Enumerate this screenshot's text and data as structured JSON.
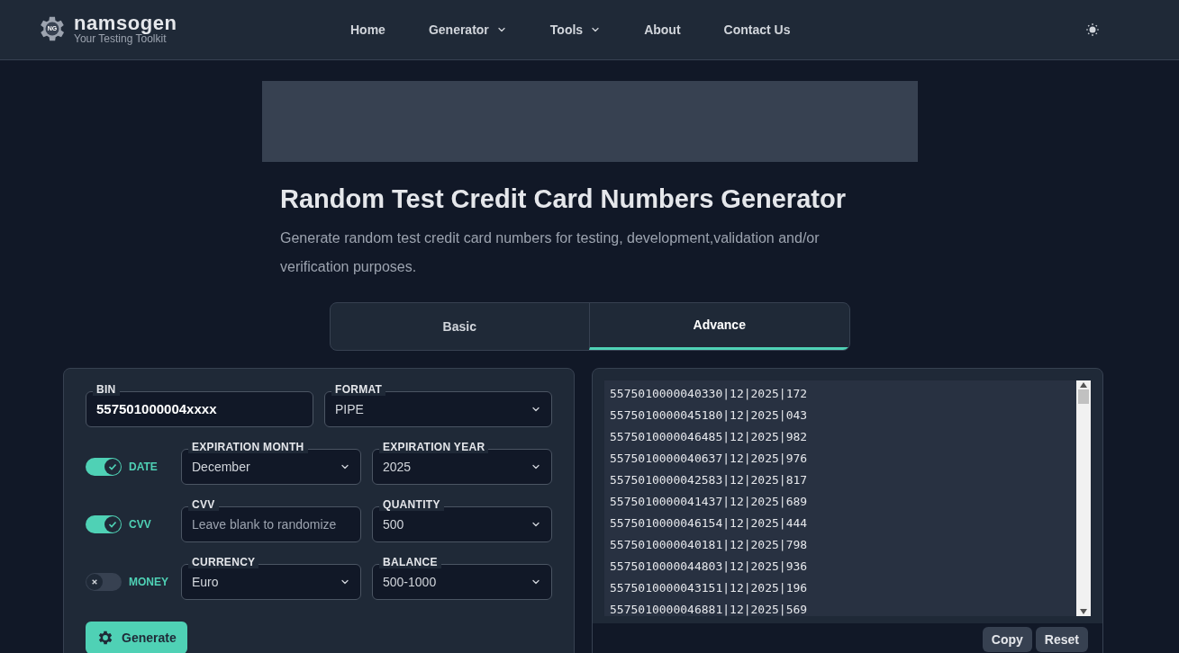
{
  "brand": {
    "name": "namsogen",
    "tagline": "Your Testing Toolkit",
    "badge": "NG"
  },
  "nav": [
    {
      "label": "Home",
      "dropdown": false
    },
    {
      "label": "Generator",
      "dropdown": true
    },
    {
      "label": "Tools",
      "dropdown": true
    },
    {
      "label": "About",
      "dropdown": false
    },
    {
      "label": "Contact Us",
      "dropdown": false
    }
  ],
  "page": {
    "title": "Random Test Credit Card Numbers Generator",
    "description": "Generate random test credit card numbers for testing, development,validation and/or verification purposes."
  },
  "tabs": [
    {
      "label": "Basic",
      "selected": false
    },
    {
      "label": "Advance",
      "selected": true
    }
  ],
  "form": {
    "bin": {
      "label": "BIN",
      "value": "557501000004xxxx"
    },
    "format": {
      "label": "FORMAT",
      "value": "PIPE"
    },
    "rows": [
      {
        "toggle": {
          "label": "DATE",
          "on": true
        },
        "fields": [
          {
            "kind": "select",
            "label": "EXPIRATION MONTH",
            "value": "December"
          },
          {
            "kind": "select",
            "label": "EXPIRATION YEAR",
            "value": "2025"
          }
        ]
      },
      {
        "toggle": {
          "label": "CVV",
          "on": true
        },
        "fields": [
          {
            "kind": "input",
            "label": "CVV",
            "placeholder": "Leave blank to randomize"
          },
          {
            "kind": "select",
            "label": "QUANTITY",
            "value": "500"
          }
        ]
      },
      {
        "toggle": {
          "label": "MONEY",
          "on": false
        },
        "fields": [
          {
            "kind": "select",
            "label": "CURRENCY",
            "value": "Euro"
          },
          {
            "kind": "select",
            "label": "BALANCE",
            "value": "500-1000"
          }
        ]
      }
    ],
    "generate": "Generate"
  },
  "output": {
    "lines": [
      "5575010000040330|12|2025|172",
      "5575010000045180|12|2025|043",
      "5575010000046485|12|2025|982",
      "5575010000040637|12|2025|976",
      "5575010000042583|12|2025|817",
      "5575010000041437|12|2025|689",
      "5575010000046154|12|2025|444",
      "5575010000040181|12|2025|798",
      "5575010000044803|12|2025|936",
      "5575010000043151|12|2025|196",
      "5575010000046881|12|2025|569"
    ],
    "buttons": [
      "Copy",
      "Reset"
    ]
  }
}
